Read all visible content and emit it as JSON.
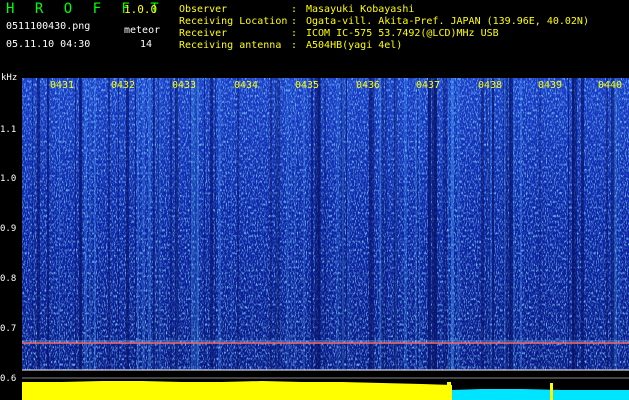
{
  "app": {
    "name": "H R O F F T",
    "version": "1.0.0"
  },
  "file": {
    "name": "0511100430.png",
    "datetime": "05.11.10 04:30"
  },
  "meteor": {
    "label": "meteor",
    "count": "14"
  },
  "info": [
    {
      "key": "Observer",
      "sep": ":",
      "value": "Masayuki Kobayashi"
    },
    {
      "key": "Receiving Location",
      "sep": ":",
      "value": "Ogata-vill. Akita-Pref. JAPAN (139.96E, 40.02N)"
    },
    {
      "key": "Receiver",
      "sep": ":",
      "value": "ICOM IC-575 53.7492(@LCD)MHz USB"
    },
    {
      "key": "Receiving antenna",
      "sep": ":",
      "value": "A504HB(yagi 4el)"
    }
  ],
  "y_axis": {
    "unit": "kHz",
    "ticks": [
      "1.1",
      "1.0",
      "0.9",
      "0.8",
      "0.7",
      "0.6"
    ]
  },
  "x_axis": {
    "ticks": [
      "0431",
      "0432",
      "0433",
      "0434",
      "0435",
      "0436",
      "0437",
      "0438",
      "0439",
      "0440"
    ]
  },
  "colors": {
    "background": "#000000",
    "spectrogram_base": "#0a1a8a",
    "noise_light": "#3aa0ff",
    "carrier_line": "#ff6a6a",
    "signal_bar": "#ffff00",
    "signal_bar_alt": "#00e5ff",
    "label_yellow": "#ffff00",
    "logo_green": "#00ff00"
  }
}
